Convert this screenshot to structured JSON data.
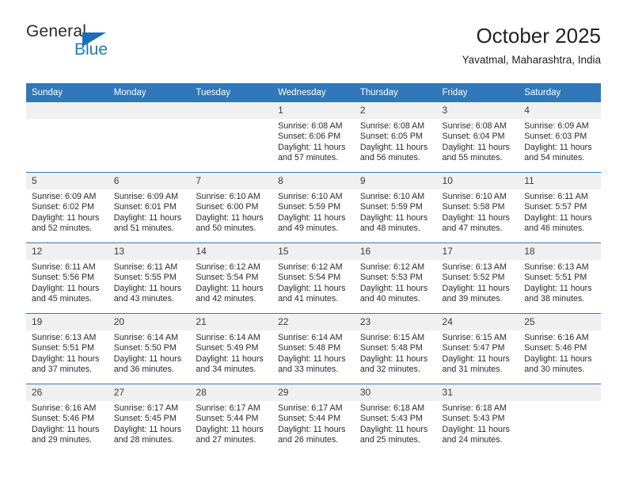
{
  "brand": {
    "name_top": "General",
    "name_bottom": "Blue",
    "triangle_color": "#1f6eb5",
    "blue_text_color": "#1f7ac4"
  },
  "header": {
    "title": "October 2025",
    "location": "Yavatmal, Maharashtra, India"
  },
  "theme": {
    "header_blue": "#3277b7",
    "date_strip_gray": "#f0f0f0",
    "row_divider": "#3277b7"
  },
  "calendar": {
    "weekday_headers": [
      "Sunday",
      "Monday",
      "Tuesday",
      "Wednesday",
      "Thursday",
      "Friday",
      "Saturday"
    ],
    "labels": {
      "sunrise_prefix": "Sunrise:",
      "sunset_prefix": "Sunset:",
      "daylight_prefix": "Daylight:"
    },
    "weeks": [
      [
        {
          "day": "",
          "sunrise": "",
          "sunset": "",
          "daylight_line1": "",
          "daylight_line2": ""
        },
        {
          "day": "",
          "sunrise": "",
          "sunset": "",
          "daylight_line1": "",
          "daylight_line2": ""
        },
        {
          "day": "",
          "sunrise": "",
          "sunset": "",
          "daylight_line1": "",
          "daylight_line2": ""
        },
        {
          "day": "1",
          "sunrise": "Sunrise: 6:08 AM",
          "sunset": "Sunset: 6:06 PM",
          "daylight_line1": "Daylight: 11 hours",
          "daylight_line2": "and 57 minutes."
        },
        {
          "day": "2",
          "sunrise": "Sunrise: 6:08 AM",
          "sunset": "Sunset: 6:05 PM",
          "daylight_line1": "Daylight: 11 hours",
          "daylight_line2": "and 56 minutes."
        },
        {
          "day": "3",
          "sunrise": "Sunrise: 6:08 AM",
          "sunset": "Sunset: 6:04 PM",
          "daylight_line1": "Daylight: 11 hours",
          "daylight_line2": "and 55 minutes."
        },
        {
          "day": "4",
          "sunrise": "Sunrise: 6:09 AM",
          "sunset": "Sunset: 6:03 PM",
          "daylight_line1": "Daylight: 11 hours",
          "daylight_line2": "and 54 minutes."
        }
      ],
      [
        {
          "day": "5",
          "sunrise": "Sunrise: 6:09 AM",
          "sunset": "Sunset: 6:02 PM",
          "daylight_line1": "Daylight: 11 hours",
          "daylight_line2": "and 52 minutes."
        },
        {
          "day": "6",
          "sunrise": "Sunrise: 6:09 AM",
          "sunset": "Sunset: 6:01 PM",
          "daylight_line1": "Daylight: 11 hours",
          "daylight_line2": "and 51 minutes."
        },
        {
          "day": "7",
          "sunrise": "Sunrise: 6:10 AM",
          "sunset": "Sunset: 6:00 PM",
          "daylight_line1": "Daylight: 11 hours",
          "daylight_line2": "and 50 minutes."
        },
        {
          "day": "8",
          "sunrise": "Sunrise: 6:10 AM",
          "sunset": "Sunset: 5:59 PM",
          "daylight_line1": "Daylight: 11 hours",
          "daylight_line2": "and 49 minutes."
        },
        {
          "day": "9",
          "sunrise": "Sunrise: 6:10 AM",
          "sunset": "Sunset: 5:59 PM",
          "daylight_line1": "Daylight: 11 hours",
          "daylight_line2": "and 48 minutes."
        },
        {
          "day": "10",
          "sunrise": "Sunrise: 6:10 AM",
          "sunset": "Sunset: 5:58 PM",
          "daylight_line1": "Daylight: 11 hours",
          "daylight_line2": "and 47 minutes."
        },
        {
          "day": "11",
          "sunrise": "Sunrise: 6:11 AM",
          "sunset": "Sunset: 5:57 PM",
          "daylight_line1": "Daylight: 11 hours",
          "daylight_line2": "and 46 minutes."
        }
      ],
      [
        {
          "day": "12",
          "sunrise": "Sunrise: 6:11 AM",
          "sunset": "Sunset: 5:56 PM",
          "daylight_line1": "Daylight: 11 hours",
          "daylight_line2": "and 45 minutes."
        },
        {
          "day": "13",
          "sunrise": "Sunrise: 6:11 AM",
          "sunset": "Sunset: 5:55 PM",
          "daylight_line1": "Daylight: 11 hours",
          "daylight_line2": "and 43 minutes."
        },
        {
          "day": "14",
          "sunrise": "Sunrise: 6:12 AM",
          "sunset": "Sunset: 5:54 PM",
          "daylight_line1": "Daylight: 11 hours",
          "daylight_line2": "and 42 minutes."
        },
        {
          "day": "15",
          "sunrise": "Sunrise: 6:12 AM",
          "sunset": "Sunset: 5:54 PM",
          "daylight_line1": "Daylight: 11 hours",
          "daylight_line2": "and 41 minutes."
        },
        {
          "day": "16",
          "sunrise": "Sunrise: 6:12 AM",
          "sunset": "Sunset: 5:53 PM",
          "daylight_line1": "Daylight: 11 hours",
          "daylight_line2": "and 40 minutes."
        },
        {
          "day": "17",
          "sunrise": "Sunrise: 6:13 AM",
          "sunset": "Sunset: 5:52 PM",
          "daylight_line1": "Daylight: 11 hours",
          "daylight_line2": "and 39 minutes."
        },
        {
          "day": "18",
          "sunrise": "Sunrise: 6:13 AM",
          "sunset": "Sunset: 5:51 PM",
          "daylight_line1": "Daylight: 11 hours",
          "daylight_line2": "and 38 minutes."
        }
      ],
      [
        {
          "day": "19",
          "sunrise": "Sunrise: 6:13 AM",
          "sunset": "Sunset: 5:51 PM",
          "daylight_line1": "Daylight: 11 hours",
          "daylight_line2": "and 37 minutes."
        },
        {
          "day": "20",
          "sunrise": "Sunrise: 6:14 AM",
          "sunset": "Sunset: 5:50 PM",
          "daylight_line1": "Daylight: 11 hours",
          "daylight_line2": "and 36 minutes."
        },
        {
          "day": "21",
          "sunrise": "Sunrise: 6:14 AM",
          "sunset": "Sunset: 5:49 PM",
          "daylight_line1": "Daylight: 11 hours",
          "daylight_line2": "and 34 minutes."
        },
        {
          "day": "22",
          "sunrise": "Sunrise: 6:14 AM",
          "sunset": "Sunset: 5:48 PM",
          "daylight_line1": "Daylight: 11 hours",
          "daylight_line2": "and 33 minutes."
        },
        {
          "day": "23",
          "sunrise": "Sunrise: 6:15 AM",
          "sunset": "Sunset: 5:48 PM",
          "daylight_line1": "Daylight: 11 hours",
          "daylight_line2": "and 32 minutes."
        },
        {
          "day": "24",
          "sunrise": "Sunrise: 6:15 AM",
          "sunset": "Sunset: 5:47 PM",
          "daylight_line1": "Daylight: 11 hours",
          "daylight_line2": "and 31 minutes."
        },
        {
          "day": "25",
          "sunrise": "Sunrise: 6:16 AM",
          "sunset": "Sunset: 5:46 PM",
          "daylight_line1": "Daylight: 11 hours",
          "daylight_line2": "and 30 minutes."
        }
      ],
      [
        {
          "day": "26",
          "sunrise": "Sunrise: 6:16 AM",
          "sunset": "Sunset: 5:46 PM",
          "daylight_line1": "Daylight: 11 hours",
          "daylight_line2": "and 29 minutes."
        },
        {
          "day": "27",
          "sunrise": "Sunrise: 6:17 AM",
          "sunset": "Sunset: 5:45 PM",
          "daylight_line1": "Daylight: 11 hours",
          "daylight_line2": "and 28 minutes."
        },
        {
          "day": "28",
          "sunrise": "Sunrise: 6:17 AM",
          "sunset": "Sunset: 5:44 PM",
          "daylight_line1": "Daylight: 11 hours",
          "daylight_line2": "and 27 minutes."
        },
        {
          "day": "29",
          "sunrise": "Sunrise: 6:17 AM",
          "sunset": "Sunset: 5:44 PM",
          "daylight_line1": "Daylight: 11 hours",
          "daylight_line2": "and 26 minutes."
        },
        {
          "day": "30",
          "sunrise": "Sunrise: 6:18 AM",
          "sunset": "Sunset: 5:43 PM",
          "daylight_line1": "Daylight: 11 hours",
          "daylight_line2": "and 25 minutes."
        },
        {
          "day": "31",
          "sunrise": "Sunrise: 6:18 AM",
          "sunset": "Sunset: 5:43 PM",
          "daylight_line1": "Daylight: 11 hours",
          "daylight_line2": "and 24 minutes."
        },
        {
          "day": "",
          "sunrise": "",
          "sunset": "",
          "daylight_line1": "",
          "daylight_line2": ""
        }
      ]
    ]
  }
}
